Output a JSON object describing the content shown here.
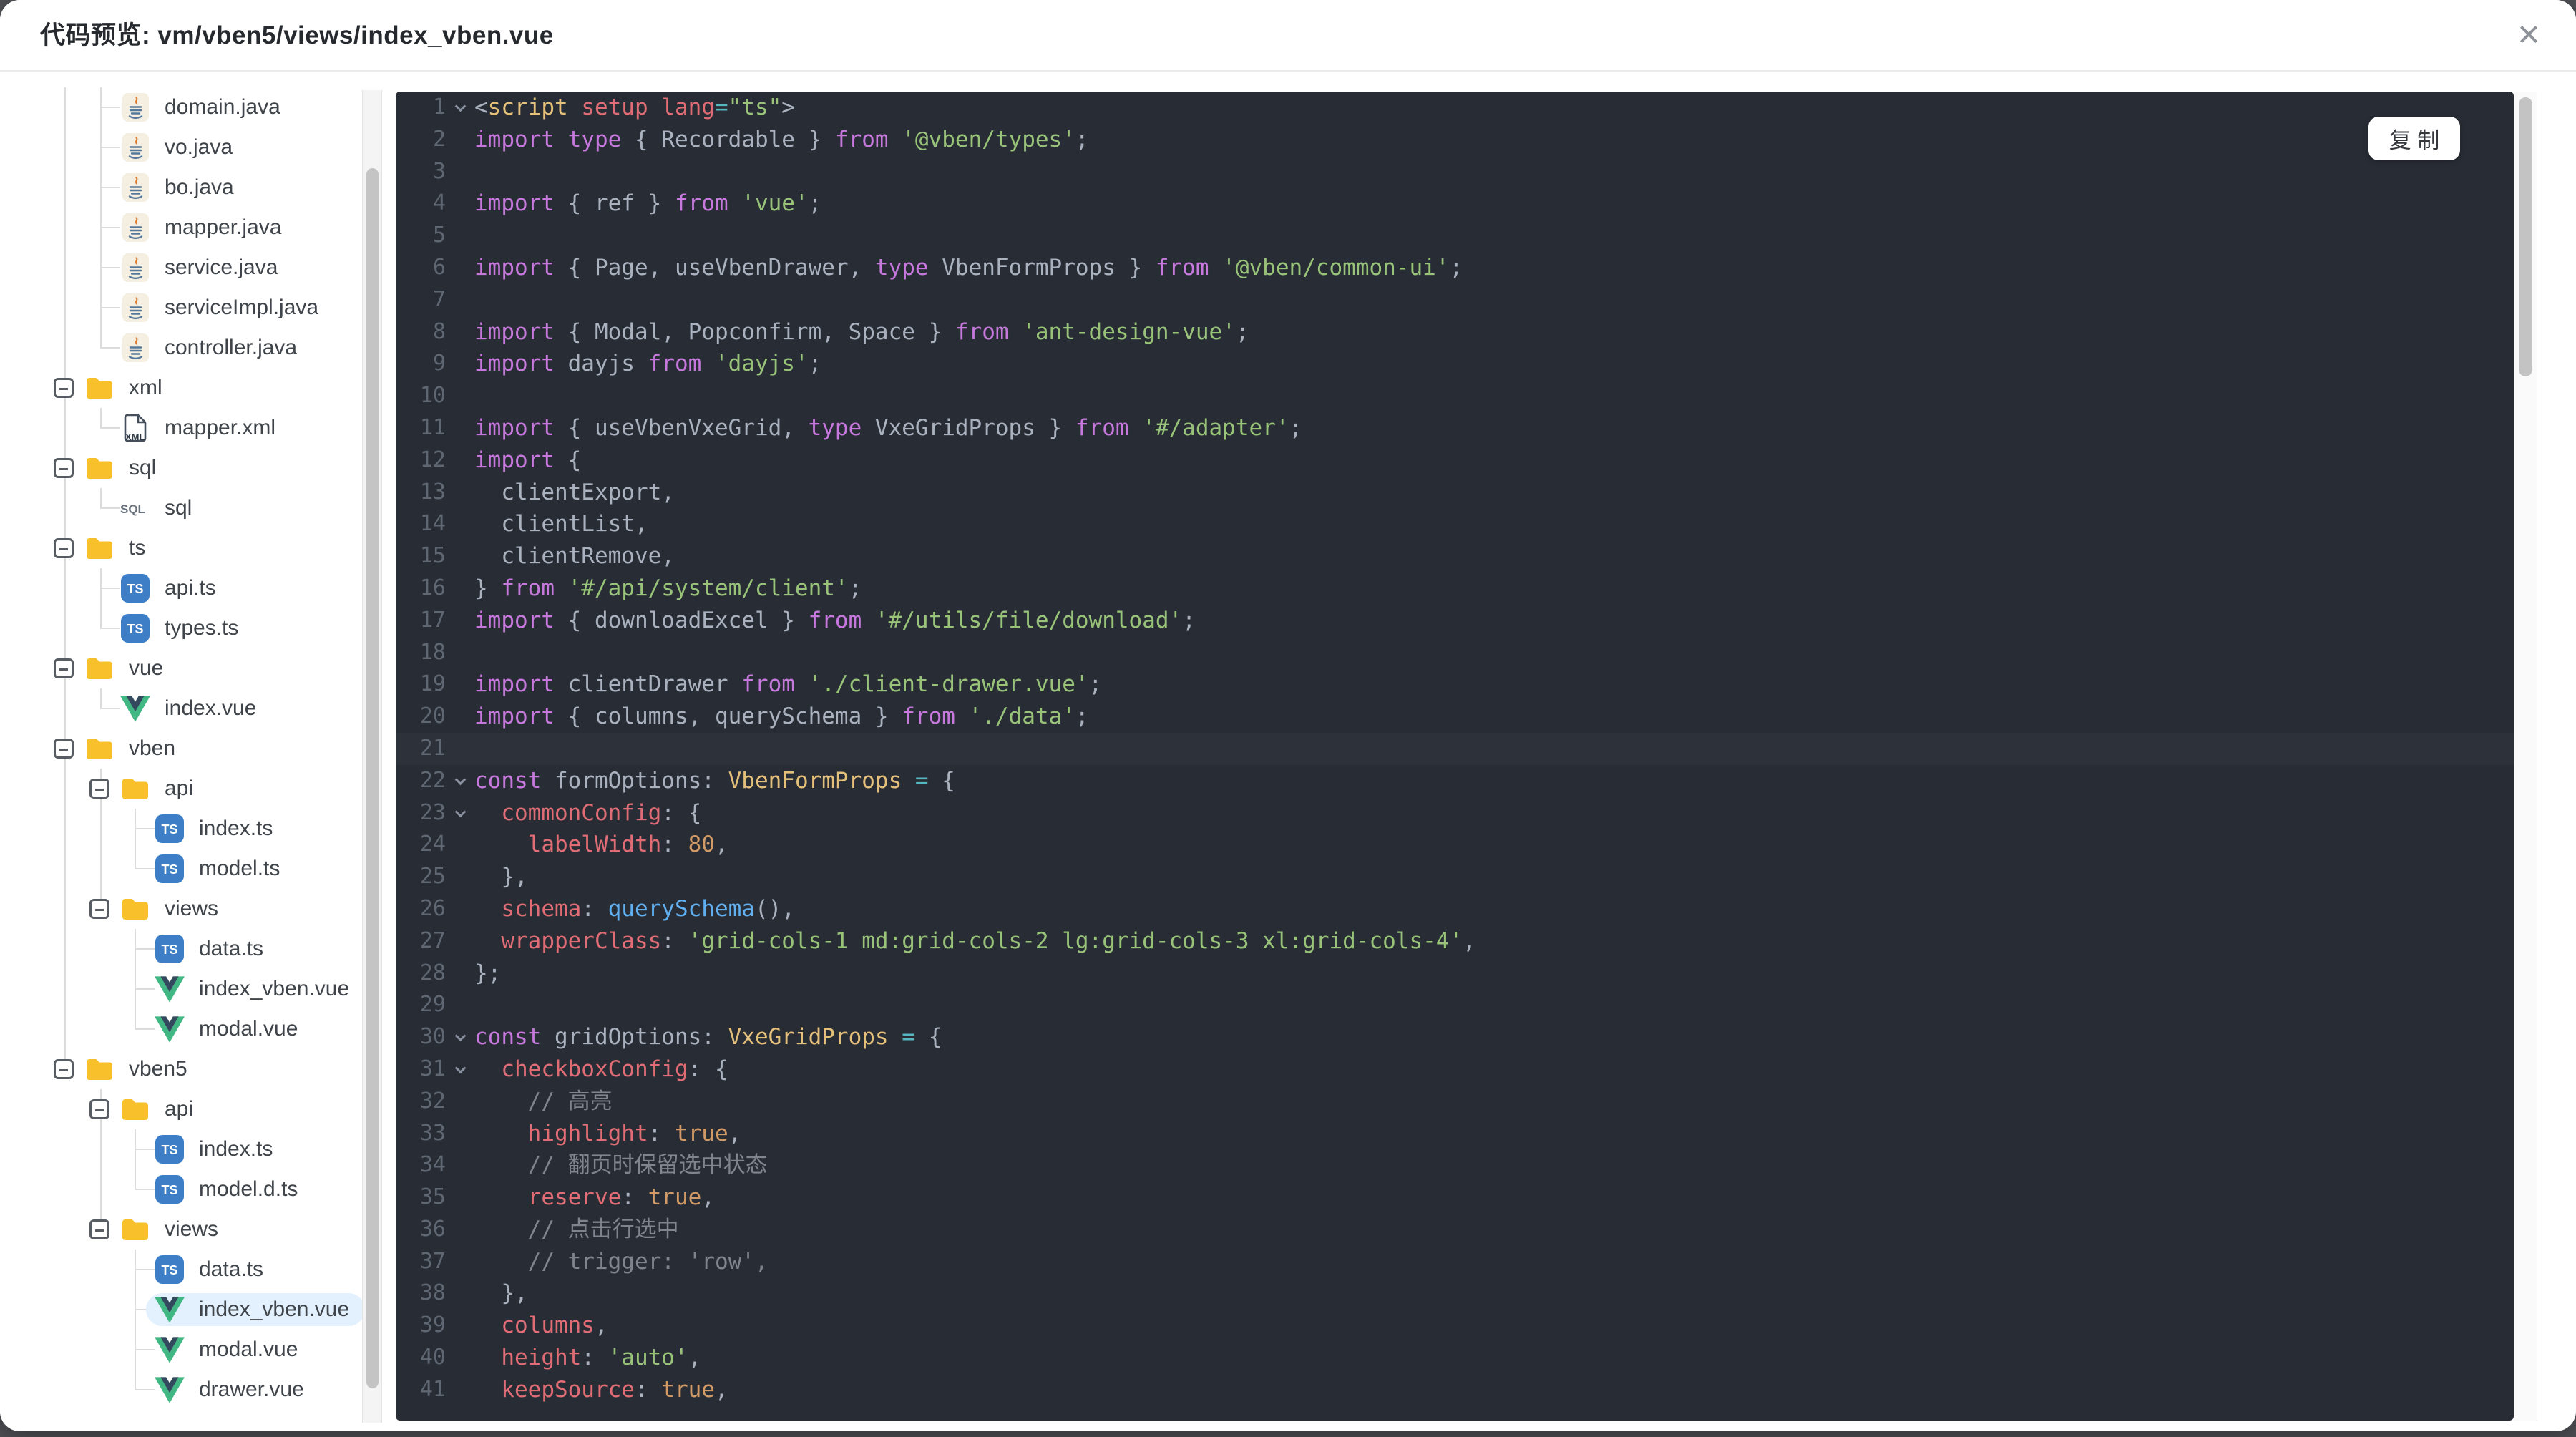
{
  "dialog": {
    "title": "代码预览: vm/vben5/views/index_vben.vue",
    "close_icon": "×"
  },
  "tree": {
    "items": [
      {
        "label": "domain.java",
        "icon": "java",
        "kind": "file",
        "lvl": 1,
        "c": 1,
        "tick": true,
        "g": [
          0
        ]
      },
      {
        "label": "vo.java",
        "icon": "java",
        "kind": "file",
        "lvl": 1,
        "c": 1,
        "tick": true,
        "g": [
          0
        ]
      },
      {
        "label": "bo.java",
        "icon": "java",
        "kind": "file",
        "lvl": 1,
        "c": 1,
        "tick": true,
        "g": [
          0
        ]
      },
      {
        "label": "mapper.java",
        "icon": "java",
        "kind": "file",
        "lvl": 1,
        "c": 1,
        "tick": true,
        "g": [
          0
        ]
      },
      {
        "label": "service.java",
        "icon": "java",
        "kind": "file",
        "lvl": 1,
        "c": 1,
        "tick": true,
        "g": [
          0
        ]
      },
      {
        "label": "serviceImpl.java",
        "icon": "java",
        "kind": "file",
        "lvl": 1,
        "c": 1,
        "tick": true,
        "g": [
          0
        ]
      },
      {
        "label": "controller.java",
        "icon": "java",
        "kind": "file",
        "lvl": 1,
        "c": 1,
        "tick": true,
        "last": true,
        "g": [
          0
        ]
      },
      {
        "label": "xml",
        "icon": "folder",
        "kind": "folder",
        "lvl": 0,
        "exp": true,
        "g": [
          0
        ]
      },
      {
        "label": "mapper.xml",
        "icon": "xml",
        "kind": "file",
        "lvl": 1,
        "c": 1,
        "tick": true,
        "last": true,
        "g": [
          0
        ]
      },
      {
        "label": "sql",
        "icon": "folder",
        "kind": "folder",
        "lvl": 0,
        "exp": true,
        "g": [
          0
        ]
      },
      {
        "label": "sql",
        "icon": "sql",
        "kind": "file",
        "lvl": 1,
        "c": 1,
        "tick": true,
        "last": true,
        "g": [
          0
        ]
      },
      {
        "label": "ts",
        "icon": "folder",
        "kind": "folder",
        "lvl": 0,
        "exp": true,
        "g": [
          0
        ]
      },
      {
        "label": "api.ts",
        "icon": "ts",
        "kind": "file",
        "lvl": 1,
        "c": 1,
        "tick": true,
        "g": [
          0
        ]
      },
      {
        "label": "types.ts",
        "icon": "ts",
        "kind": "file",
        "lvl": 1,
        "c": 1,
        "tick": true,
        "last": true,
        "g": [
          0
        ]
      },
      {
        "label": "vue",
        "icon": "folder",
        "kind": "folder",
        "lvl": 0,
        "exp": true,
        "g": [
          0
        ]
      },
      {
        "label": "index.vue",
        "icon": "vue",
        "kind": "file",
        "lvl": 1,
        "c": 1,
        "tick": true,
        "last": true,
        "g": [
          0
        ]
      },
      {
        "label": "vben",
        "icon": "folder",
        "kind": "folder",
        "lvl": 0,
        "exp": true,
        "g": [
          0
        ]
      },
      {
        "label": "api",
        "icon": "folder",
        "kind": "folder",
        "lvl": 1,
        "exp": true,
        "c": 1,
        "g": [
          0
        ]
      },
      {
        "label": "index.ts",
        "icon": "ts",
        "kind": "file",
        "lvl": 2,
        "c": 2,
        "tick": true,
        "g": [
          0,
          1
        ]
      },
      {
        "label": "model.ts",
        "icon": "ts",
        "kind": "file",
        "lvl": 2,
        "c": 2,
        "tick": true,
        "last": true,
        "g": [
          0,
          1
        ]
      },
      {
        "label": "views",
        "icon": "folder",
        "kind": "folder",
        "lvl": 1,
        "exp": true,
        "c": 1,
        "last": true,
        "g": [
          0
        ]
      },
      {
        "label": "data.ts",
        "icon": "ts",
        "kind": "file",
        "lvl": 2,
        "c": 2,
        "tick": true,
        "g": [
          0
        ]
      },
      {
        "label": "index_vben.vue",
        "icon": "vue",
        "kind": "file",
        "lvl": 2,
        "c": 2,
        "tick": true,
        "g": [
          0
        ]
      },
      {
        "label": "modal.vue",
        "icon": "vue",
        "kind": "file",
        "lvl": 2,
        "c": 2,
        "tick": true,
        "last": true,
        "g": [
          0
        ]
      },
      {
        "label": "vben5",
        "icon": "folder",
        "kind": "folder",
        "lvl": 0,
        "exp": true,
        "c": 0,
        "last": true,
        "g": []
      },
      {
        "label": "api",
        "icon": "folder",
        "kind": "folder",
        "lvl": 1,
        "exp": true,
        "c": 1,
        "g": []
      },
      {
        "label": "index.ts",
        "icon": "ts",
        "kind": "file",
        "lvl": 2,
        "c": 2,
        "tick": true,
        "g": [
          1
        ]
      },
      {
        "label": "model.d.ts",
        "icon": "ts",
        "kind": "file",
        "lvl": 2,
        "c": 2,
        "tick": true,
        "last": true,
        "g": [
          1
        ]
      },
      {
        "label": "views",
        "icon": "folder",
        "kind": "folder",
        "lvl": 1,
        "exp": true,
        "c": 1,
        "last": true,
        "g": []
      },
      {
        "label": "data.ts",
        "icon": "ts",
        "kind": "file",
        "lvl": 2,
        "c": 2,
        "tick": true,
        "g": []
      },
      {
        "label": "index_vben.vue",
        "icon": "vue",
        "kind": "file",
        "lvl": 2,
        "c": 2,
        "tick": true,
        "sel": true,
        "g": []
      },
      {
        "label": "modal.vue",
        "icon": "vue",
        "kind": "file",
        "lvl": 2,
        "c": 2,
        "tick": true,
        "g": []
      },
      {
        "label": "drawer.vue",
        "icon": "vue",
        "kind": "file",
        "lvl": 2,
        "c": 2,
        "tick": true,
        "last": true,
        "g": []
      }
    ]
  },
  "editor": {
    "copy_button": "复 制",
    "active_line": 21,
    "fold_lines": [
      1,
      22,
      23,
      30,
      31
    ],
    "lines": [
      {
        "n": 1,
        "t": [
          [
            "p",
            "<"
          ],
          [
            "t",
            "script"
          ],
          [
            "r",
            " setup"
          ],
          [
            "r",
            " lang"
          ],
          [
            "o",
            "="
          ],
          [
            "s",
            "\"ts\""
          ],
          [
            "p",
            ">"
          ]
        ]
      },
      {
        "n": 2,
        "t": [
          [
            "k",
            "import type"
          ],
          [
            "p",
            " { Recordable } "
          ],
          [
            "k",
            "from"
          ],
          [
            "s",
            " '@vben/types'"
          ],
          [
            "p",
            ";"
          ]
        ]
      },
      {
        "n": 3,
        "t": []
      },
      {
        "n": 4,
        "t": [
          [
            "k",
            "import"
          ],
          [
            "p",
            " { ref } "
          ],
          [
            "k",
            "from"
          ],
          [
            "s",
            " 'vue'"
          ],
          [
            "p",
            ";"
          ]
        ]
      },
      {
        "n": 5,
        "t": []
      },
      {
        "n": 6,
        "t": [
          [
            "k",
            "import"
          ],
          [
            "p",
            " { Page, useVbenDrawer, "
          ],
          [
            "k",
            "type"
          ],
          [
            "p",
            " VbenFormProps } "
          ],
          [
            "k",
            "from"
          ],
          [
            "s",
            " '@vben/common-ui'"
          ],
          [
            "p",
            ";"
          ]
        ]
      },
      {
        "n": 7,
        "t": []
      },
      {
        "n": 8,
        "t": [
          [
            "k",
            "import"
          ],
          [
            "p",
            " { Modal, Popconfirm, Space } "
          ],
          [
            "k",
            "from"
          ],
          [
            "s",
            " 'ant-design-vue'"
          ],
          [
            "p",
            ";"
          ]
        ]
      },
      {
        "n": 9,
        "t": [
          [
            "k",
            "import"
          ],
          [
            "p",
            " dayjs "
          ],
          [
            "k",
            "from"
          ],
          [
            "s",
            " 'dayjs'"
          ],
          [
            "p",
            ";"
          ]
        ]
      },
      {
        "n": 10,
        "t": []
      },
      {
        "n": 11,
        "t": [
          [
            "k",
            "import"
          ],
          [
            "p",
            " { useVbenVxeGrid, "
          ],
          [
            "k",
            "type"
          ],
          [
            "p",
            " VxeGridProps } "
          ],
          [
            "k",
            "from"
          ],
          [
            "s",
            " '#/adapter'"
          ],
          [
            "p",
            ";"
          ]
        ]
      },
      {
        "n": 12,
        "t": [
          [
            "k",
            "import"
          ],
          [
            "p",
            " {"
          ]
        ]
      },
      {
        "n": 13,
        "t": [
          [
            "p",
            "  clientExport,"
          ]
        ]
      },
      {
        "n": 14,
        "t": [
          [
            "p",
            "  clientList,"
          ]
        ]
      },
      {
        "n": 15,
        "t": [
          [
            "p",
            "  clientRemove,"
          ]
        ]
      },
      {
        "n": 16,
        "t": [
          [
            "p",
            "} "
          ],
          [
            "k",
            "from"
          ],
          [
            "s",
            " '#/api/system/client'"
          ],
          [
            "p",
            ";"
          ]
        ]
      },
      {
        "n": 17,
        "t": [
          [
            "k",
            "import"
          ],
          [
            "p",
            " { downloadExcel } "
          ],
          [
            "k",
            "from"
          ],
          [
            "s",
            " '#/utils/file/download'"
          ],
          [
            "p",
            ";"
          ]
        ]
      },
      {
        "n": 18,
        "t": []
      },
      {
        "n": 19,
        "t": [
          [
            "k",
            "import"
          ],
          [
            "p",
            " clientDrawer "
          ],
          [
            "k",
            "from"
          ],
          [
            "s",
            " './client-drawer.vue'"
          ],
          [
            "p",
            ";"
          ]
        ]
      },
      {
        "n": 20,
        "t": [
          [
            "k",
            "import"
          ],
          [
            "p",
            " { columns, querySchema } "
          ],
          [
            "k",
            "from"
          ],
          [
            "s",
            " './data'"
          ],
          [
            "p",
            ";"
          ]
        ]
      },
      {
        "n": 21,
        "t": []
      },
      {
        "n": 22,
        "t": [
          [
            "k",
            "const"
          ],
          [
            "p",
            " formOptions: "
          ],
          [
            "t",
            "VbenFormProps"
          ],
          [
            "o",
            " ="
          ],
          [
            "p",
            " {"
          ]
        ]
      },
      {
        "n": 23,
        "t": [
          [
            "r",
            "  commonConfig"
          ],
          [
            "p",
            ": {"
          ]
        ]
      },
      {
        "n": 24,
        "t": [
          [
            "r",
            "    labelWidth"
          ],
          [
            "p",
            ": "
          ],
          [
            "n",
            "80"
          ],
          [
            "p",
            ","
          ]
        ]
      },
      {
        "n": 25,
        "t": [
          [
            "p",
            "  },"
          ]
        ]
      },
      {
        "n": 26,
        "t": [
          [
            "r",
            "  schema"
          ],
          [
            "p",
            ": "
          ],
          [
            "f",
            "querySchema"
          ],
          [
            "p",
            "(),"
          ]
        ]
      },
      {
        "n": 27,
        "t": [
          [
            "r",
            "  wrapperClass"
          ],
          [
            "p",
            ": "
          ],
          [
            "s",
            "'grid-cols-1 md:grid-cols-2 lg:grid-cols-3 xl:grid-cols-4'"
          ],
          [
            "p",
            ","
          ]
        ]
      },
      {
        "n": 28,
        "t": [
          [
            "p",
            "};"
          ]
        ]
      },
      {
        "n": 29,
        "t": []
      },
      {
        "n": 30,
        "t": [
          [
            "k",
            "const"
          ],
          [
            "p",
            " gridOptions: "
          ],
          [
            "t",
            "VxeGridProps"
          ],
          [
            "o",
            " ="
          ],
          [
            "p",
            " {"
          ]
        ]
      },
      {
        "n": 31,
        "t": [
          [
            "r",
            "  checkboxConfig"
          ],
          [
            "p",
            ": {"
          ]
        ]
      },
      {
        "n": 32,
        "t": [
          [
            "c",
            "    // 高亮"
          ]
        ]
      },
      {
        "n": 33,
        "t": [
          [
            "r",
            "    highlight"
          ],
          [
            "p",
            ": "
          ],
          [
            "n",
            "true"
          ],
          [
            "p",
            ","
          ]
        ]
      },
      {
        "n": 34,
        "t": [
          [
            "c",
            "    // 翻页时保留选中状态"
          ]
        ]
      },
      {
        "n": 35,
        "t": [
          [
            "r",
            "    reserve"
          ],
          [
            "p",
            ": "
          ],
          [
            "n",
            "true"
          ],
          [
            "p",
            ","
          ]
        ]
      },
      {
        "n": 36,
        "t": [
          [
            "c",
            "    // 点击行选中"
          ]
        ]
      },
      {
        "n": 37,
        "t": [
          [
            "c",
            "    // trigger: 'row',"
          ]
        ]
      },
      {
        "n": 38,
        "t": [
          [
            "p",
            "  },"
          ]
        ]
      },
      {
        "n": 39,
        "t": [
          [
            "r",
            "  columns"
          ],
          [
            "p",
            ","
          ]
        ]
      },
      {
        "n": 40,
        "t": [
          [
            "r",
            "  height"
          ],
          [
            "p",
            ": "
          ],
          [
            "s",
            "'auto'"
          ],
          [
            "p",
            ","
          ]
        ]
      },
      {
        "n": 41,
        "t": [
          [
            "r",
            "  keepSource"
          ],
          [
            "p",
            ": "
          ],
          [
            "n",
            "true"
          ],
          [
            "p",
            ","
          ]
        ]
      }
    ]
  },
  "colors": {
    "selected_file_bg": "#e2f1fd",
    "folder_yellow": "#f8c12c",
    "ts_badge_blue": "#3d7ec6",
    "vue_green": "#41b883",
    "vue_navy": "#35495e",
    "java_steam_orange": "#e07b2e",
    "java_cup_blue": "#56799b",
    "editor_bg": "#282c34",
    "editor_active_line": "#2c313a",
    "syntax_keyword": "#c678dd",
    "syntax_string": "#98c379",
    "syntax_type": "#e5c07b",
    "syntax_property": "#e06c75",
    "syntax_number": "#d19a66",
    "syntax_function": "#61afef",
    "syntax_operator": "#56b6c2",
    "syntax_comment": "#7f848e",
    "syntax_default": "#abb2bf"
  }
}
